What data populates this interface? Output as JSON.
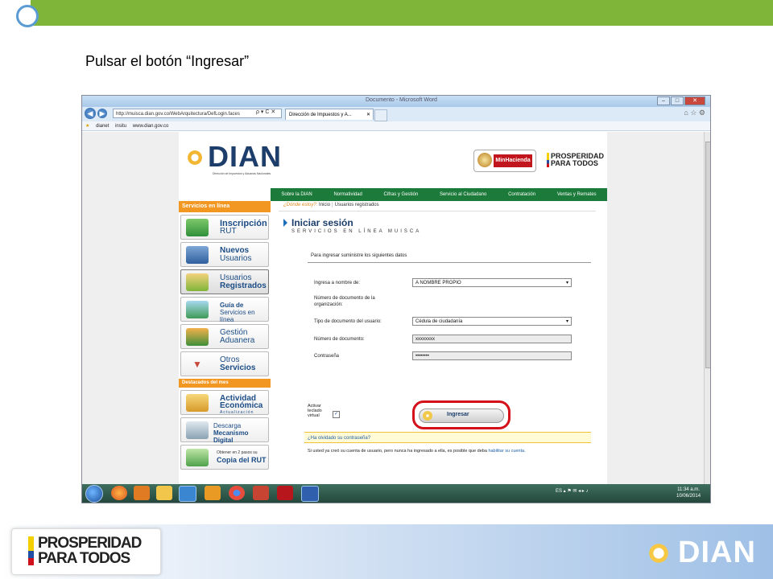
{
  "slide": {
    "instruction": "Pulsar el botón “Ingresar”",
    "footer_left_logo": "PROSPERIDAD PARA TODOS",
    "footer_right_logo": "DIAN",
    "accent_green": "#7fb539",
    "highlight_red": "#d4101a"
  },
  "browser": {
    "window_title": "Documento - Microsoft Word",
    "url": "http://muisca.dian.gov.co/WebArquitectura/DefLogin.faces",
    "url_icons": "ρ ▾ C ✕",
    "tab_label": "Dirección de Impuestos y A...",
    "tab_close": "✕",
    "favorites": [
      "dianet",
      "insitu",
      "www.dian.gov.co"
    ],
    "toolbar_icons": "⌂ ☆ ⚙"
  },
  "site": {
    "logo": "DIAN",
    "logo_subtitle": "Dirección de Impuestos y Aduanas Nacionales",
    "minhacienda": "MinHacienda",
    "prosperidad": "PROSPERIDAD PARA TODOS",
    "topnav": [
      "Sobre la DIAN",
      "Normatividad",
      "Cifras y Gestión",
      "Servicio al Ciudadano",
      "Contratación",
      "Ventas y Remates"
    ],
    "breadcrumb": {
      "prompt": "¿Dónde estoy?:",
      "home": "Inicio",
      "sep": "|",
      "current": "Usuarios registrados"
    },
    "sidebar": {
      "header": "Servicios en línea",
      "items": [
        {
          "line1": "Inscripción",
          "line2": "RUT"
        },
        {
          "line1": "Nuevos",
          "line2": "Usuarios"
        },
        {
          "line1": "Usuarios",
          "line2": "Registrados"
        },
        {
          "line1": "Guía de",
          "line2": "Servicios en línea"
        },
        {
          "line1": "Gestión",
          "line2": "Aduanera"
        },
        {
          "line1": "Otros",
          "line2": "Servicios"
        }
      ],
      "featured_header": "Destacados del mes",
      "featured": [
        {
          "line1": "Actividad",
          "line2": "Económica",
          "line3": "Actualización"
        },
        {
          "line1": "Descarga",
          "line2": "Mecanismo Digital"
        },
        {
          "line1": "Obtener en 2 pasos su",
          "line2": "Copia del RUT"
        }
      ]
    },
    "login": {
      "title": "Iniciar sesión",
      "subtitle": "SERVICIOS EN LÍNEA MUISCA",
      "intro": "Para ingresar suministre los siguientes datos",
      "fields": {
        "acting_label": "Ingresa a nombre de:",
        "acting_value": "A NOMBRE PROPIO",
        "org_doc_label": "Número de documento de la organización:",
        "doc_type_label": "Tipo de documento del usuario:",
        "doc_type_value": "Cédula de ciudadanía",
        "doc_number_label": "Número de documento:",
        "doc_number_value": "xxxxxxxx",
        "password_label": "Contraseña",
        "password_value": "••••••••"
      },
      "keyboard_label": "Activar teclado virtual",
      "keyboard_checked": "✓",
      "submit": "Ingresar",
      "forgot": "¿Ha olvidado su contraseña?",
      "note": "Si usted ya creó su cuenta de usuario, pero nunca ha ingresado a ella, es posible que deba",
      "note_link": "habilitar su cuenta."
    }
  },
  "taskbar": {
    "lang": "ES",
    "time": "11:34 a.m.",
    "date": "10/06/2014"
  }
}
